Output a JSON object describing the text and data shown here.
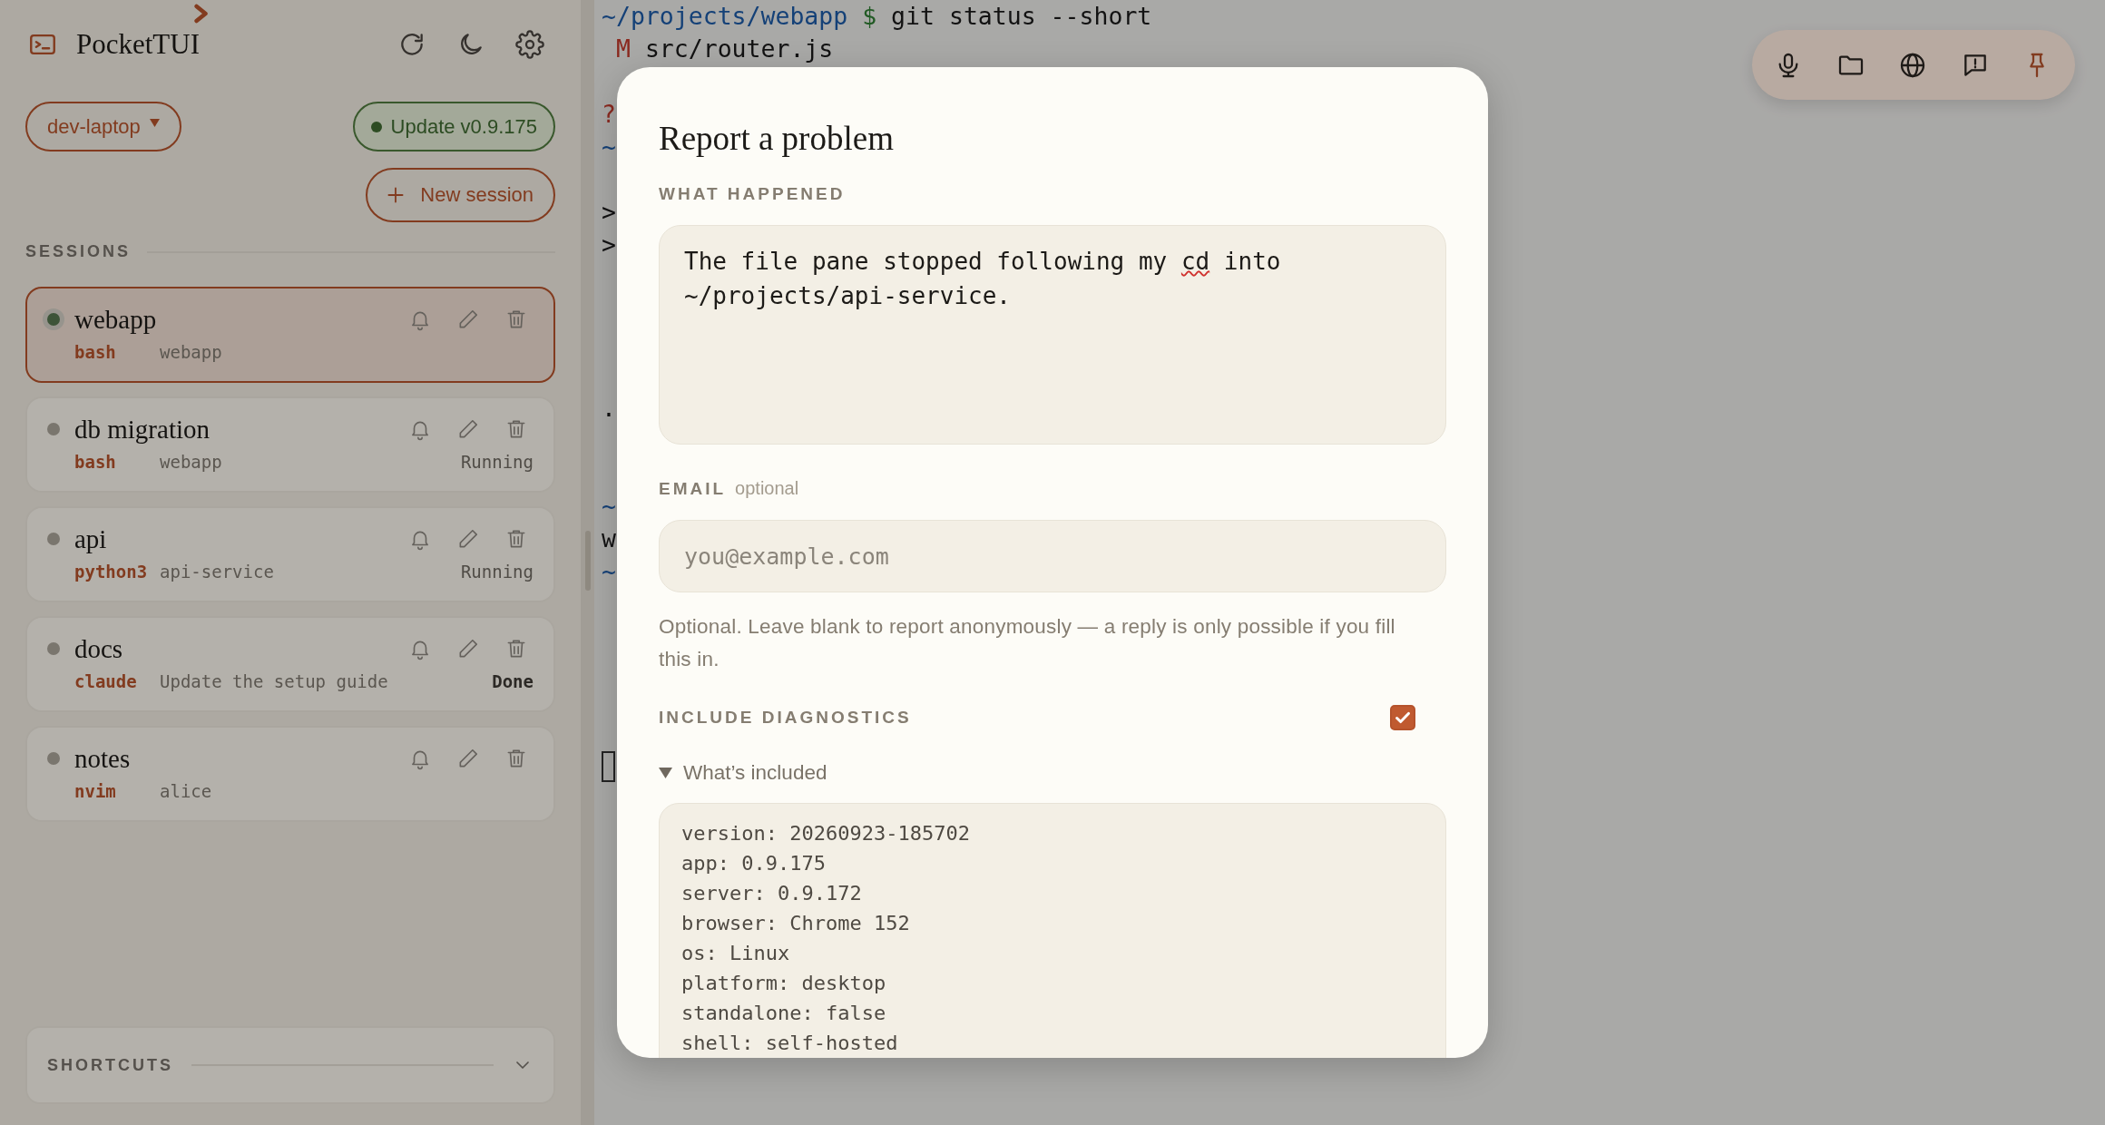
{
  "app": {
    "title": "PocketTUI"
  },
  "header_actions": [
    {
      "kind": "refresh"
    },
    {
      "kind": "theme"
    },
    {
      "kind": "settings"
    }
  ],
  "host_selector": {
    "label": "dev-laptop"
  },
  "update_button": {
    "label": "Update v0.9.175"
  },
  "new_session_button": {
    "label": "New session"
  },
  "sessions": {
    "heading": "SESSIONS",
    "items": [
      {
        "name": "webapp",
        "command": "bash",
        "directory": "webapp",
        "selected": true,
        "color": "#3d5438"
      },
      {
        "name": "db migration",
        "command": "bash",
        "directory": "webapp",
        "selected": false,
        "color": "#7a766e",
        "status": {
          "text": "Running",
          "kind": "running"
        }
      },
      {
        "name": "api",
        "command": "python3",
        "directory": "api-service",
        "selected": false,
        "color": "#7a766e",
        "status": {
          "text": "Running",
          "kind": "running"
        }
      },
      {
        "name": "docs",
        "command": "claude",
        "directory": "Update the setup guide",
        "selected": false,
        "color": "#7a766e",
        "status": {
          "text": "Done",
          "kind": "done"
        }
      },
      {
        "name": "notes",
        "command": "nvim",
        "directory": "alice",
        "selected": false,
        "color": "#7a766e"
      }
    ]
  },
  "shortcuts": {
    "heading": "SHORTCUTS",
    "expanded": false
  },
  "terminal": {
    "lines": [
      {
        "segments": [
          {
            "text": "~/projects/webapp",
            "kind": "path"
          },
          {
            "text": " $",
            "kind": "prompt"
          },
          {
            "text": " git status --short",
            "kind": "plain"
          }
        ]
      },
      {
        "segments": [
          {
            "text": " M",
            "kind": "modified"
          },
          {
            "text": " src/router.js",
            "kind": "plain"
          }
        ]
      },
      {
        "kind": "blank"
      },
      {
        "segments": [
          {
            "text": "?",
            "kind": "untracked"
          }
        ]
      },
      {
        "segments": [
          {
            "text": "~",
            "kind": "path"
          }
        ]
      },
      {
        "kind": "blank"
      },
      {
        "segments": [
          {
            "text": ">",
            "kind": "plain"
          }
        ]
      },
      {
        "segments": [
          {
            "text": ">",
            "kind": "plain"
          }
        ]
      },
      {
        "kind": "blank"
      },
      {
        "kind": "blank"
      },
      {
        "kind": "blank"
      },
      {
        "kind": "blank"
      },
      {
        "segments": [
          {
            "text": ".",
            "kind": "plain"
          }
        ]
      },
      {
        "kind": "blank"
      },
      {
        "kind": "blank"
      },
      {
        "segments": [
          {
            "text": "~",
            "kind": "path"
          }
        ]
      },
      {
        "segments": [
          {
            "text": "w",
            "kind": "plain"
          }
        ]
      },
      {
        "segments": [
          {
            "text": "~",
            "kind": "path"
          }
        ]
      },
      {
        "kind": "blank"
      },
      {
        "kind": "blank"
      },
      {
        "kind": "blank"
      },
      {
        "kind": "blank"
      },
      {
        "kind": "blank"
      },
      {
        "kind": "cursor"
      }
    ]
  },
  "toolbar": [
    {
      "kind": "mic",
      "active": false
    },
    {
      "kind": "folder",
      "active": false
    },
    {
      "kind": "globe",
      "active": false
    },
    {
      "kind": "feedback",
      "active": false
    },
    {
      "kind": "pin",
      "active": true
    }
  ],
  "dialog": {
    "title": "Report a problem",
    "description_label": "WHAT HAPPENED",
    "description_value": [
      {
        "text": "The file pane stopped following my ",
        "flagged": false
      },
      {
        "text": "cd",
        "flagged": true
      },
      {
        "text": " into ~/projects/api-service.",
        "flagged": false
      }
    ],
    "email_label": "EMAIL",
    "email_note": "optional",
    "email_placeholder": "you@example.com",
    "email_help": "Optional. Leave blank to report anonymously — a reply is only possible if you fill this in.",
    "diagnostics_label": "INCLUDE DIAGNOSTICS",
    "diagnostics_checked": true,
    "details_summary": "What’s included",
    "details_expanded": true,
    "diagnostics": [
      "version: 20260923-185702",
      "app: 0.9.175",
      "server: 0.9.172",
      "browser: Chrome 152",
      "os: Linux",
      "platform: desktop",
      "standalone: false",
      "shell: self-hosted"
    ]
  }
}
